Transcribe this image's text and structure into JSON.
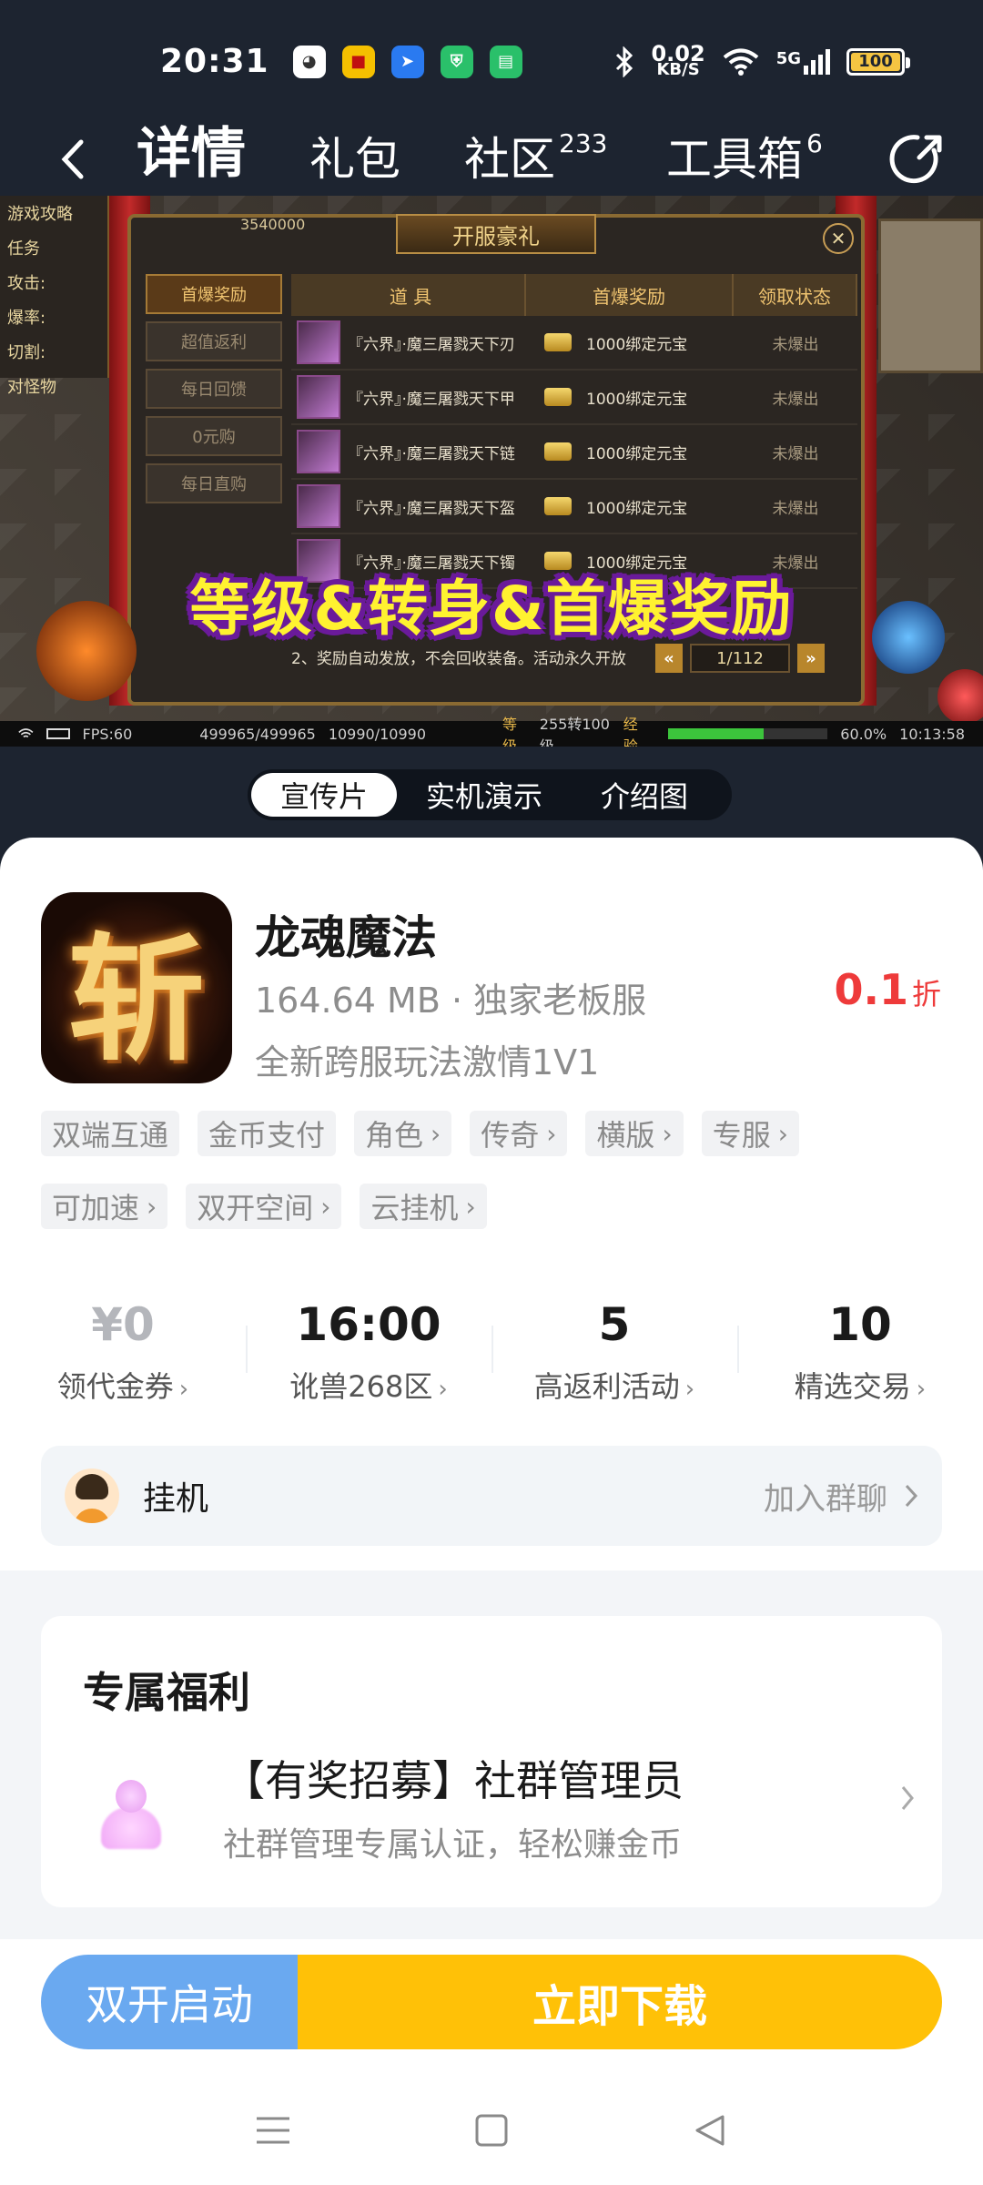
{
  "status_bar": {
    "time": "20:31",
    "net_speed_value": "0.02",
    "net_speed_unit": "KB/S",
    "signal_label": "5G",
    "battery": "100"
  },
  "nav": {
    "tabs": [
      {
        "label": "详情",
        "badge": ""
      },
      {
        "label": "礼包",
        "badge": ""
      },
      {
        "label": "社区",
        "badge": "233"
      },
      {
        "label": "工具箱",
        "badge": "6"
      }
    ]
  },
  "media": {
    "left_panel": [
      "游戏攻略",
      "任务",
      "攻击:",
      "爆率:",
      "切割:",
      "对怪物"
    ],
    "frame_title": "开服豪礼",
    "top_stats": "3540000",
    "side_menu": [
      "首爆奖励",
      "超值返利",
      "每日回馈",
      "0元购",
      "每日直购"
    ],
    "table_headers": [
      "道 具",
      "首爆奖励",
      "领取状态"
    ],
    "rows": [
      {
        "item": "『六界』·魔三屠戮天下刃",
        "reward": "1000绑定元宝",
        "status": "未爆出"
      },
      {
        "item": "『六界』·魔三屠戮天下甲",
        "reward": "1000绑定元宝",
        "status": "未爆出"
      },
      {
        "item": "『六界』·魔三屠戮天下链",
        "reward": "1000绑定元宝",
        "status": "未爆出"
      },
      {
        "item": "『六界』·魔三屠戮天下盔",
        "reward": "1000绑定元宝",
        "status": "未爆出"
      },
      {
        "item": "『六界』·魔三屠戮天下镯",
        "reward": "1000绑定元宝",
        "status": "未爆出"
      }
    ],
    "footnote": "2、奖励自动发放，不会回收装备。活动永久开放",
    "pager": "1/112",
    "overlay_text": "等级&转身&首爆奖励",
    "hud": {
      "fps": "FPS:60",
      "hp": "499965/499965",
      "mp": "10990/10990",
      "level_label": "等级",
      "level": "255转100级",
      "exp_label": "经验",
      "exp_percent": "60.0%",
      "clock": "10:13:58"
    },
    "tabs": [
      "宣传片",
      "实机演示",
      "介绍图"
    ]
  },
  "game": {
    "icon_glyph": "斩",
    "name": "龙魂魔法",
    "meta": "164.64 MB · 独家老板服",
    "description": "全新跨服玩法激情1V1",
    "discount_value": "0.1",
    "discount_unit": "折",
    "tags": [
      {
        "label": "双端互通",
        "chevron": false
      },
      {
        "label": "金币支付",
        "chevron": false
      },
      {
        "label": "角色",
        "chevron": true
      },
      {
        "label": "传奇",
        "chevron": true
      },
      {
        "label": "横版",
        "chevron": true
      },
      {
        "label": "专服",
        "chevron": true
      },
      {
        "label": "可加速",
        "chevron": true
      },
      {
        "label": "双开空间",
        "chevron": true
      },
      {
        "label": "云挂机",
        "chevron": true
      }
    ]
  },
  "stats": [
    {
      "value": "¥0",
      "label": "领代金券"
    },
    {
      "value": "16:00",
      "label": "讹兽268区"
    },
    {
      "value": "5",
      "label": "高返利活动"
    },
    {
      "value": "10",
      "label": "精选交易"
    }
  ],
  "group": {
    "name": "挂机",
    "join_label": "加入群聊"
  },
  "benefit": {
    "title": "专属福利",
    "heading": "【有奖招募】社群管理员",
    "subtitle": "社群管理专属认证，轻松赚金币"
  },
  "actions": {
    "dual_launch": "双开启动",
    "download": "立即下载"
  },
  "colors": {
    "accent_download": "#ffc107",
    "accent_dual": "#6aa9f0",
    "discount_red": "#ee3a3a",
    "header_bg": "#1d2430"
  }
}
